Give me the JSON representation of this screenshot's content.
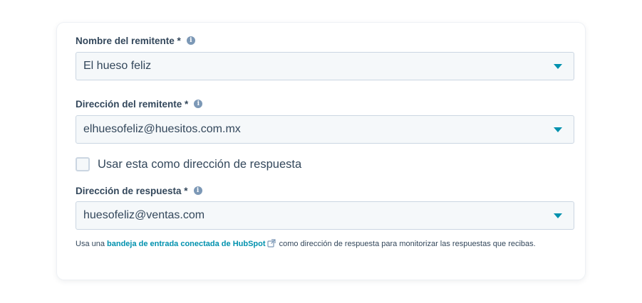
{
  "sender_name": {
    "label": "Nombre del remitente *",
    "value": "El hueso feliz"
  },
  "sender_address": {
    "label": "Dirección del remitente *",
    "value": "elhuesofeliz@huesitos.com.mx"
  },
  "use_as_reply": {
    "label": "Usar esta como dirección de respuesta",
    "checked": false
  },
  "reply_address": {
    "label": "Dirección de respuesta *",
    "value": "huesofeliz@ventas.com"
  },
  "help": {
    "prefix": "Usa una ",
    "link": "bandeja de entrada conectada de HubSpot",
    "suffix": " como dirección de respuesta para monitorizar las respuestas que recibas."
  },
  "icons": {
    "info": "info-icon",
    "caret": "chevron-down-icon",
    "external": "external-link-icon"
  },
  "colors": {
    "accent": "#0091ae",
    "text": "#33475b",
    "field_bg": "#f5f8fa",
    "field_border": "#cbd6e2"
  }
}
